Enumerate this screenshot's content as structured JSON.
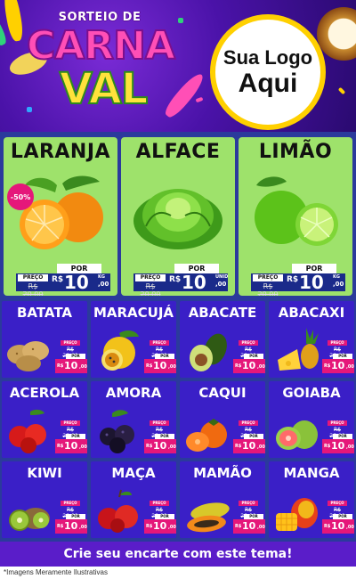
{
  "header": {
    "title_top": "SORTEIO DE",
    "title_line1": "CARNA",
    "title_line2": "VAL",
    "logo_line1": "Sua Logo",
    "logo_line2": "Aqui"
  },
  "featured": [
    {
      "name": "LARANJA",
      "badge": "-50%",
      "preco_label": "PREÇO",
      "old_price": "R$ 20,00",
      "por_label": "POR",
      "currency": "R$",
      "price": "10",
      "cents": ",00",
      "unit": "KG",
      "icon": "orange-icon"
    },
    {
      "name": "ALFACE",
      "badge": "",
      "preco_label": "PREÇO",
      "old_price": "R$ 20,00",
      "por_label": "POR",
      "currency": "R$",
      "price": "10",
      "cents": ",00",
      "unit": "UNID",
      "icon": "lettuce-icon"
    },
    {
      "name": "LIMÃO",
      "badge": "",
      "preco_label": "PREÇO",
      "old_price": "R$ 20,00",
      "por_label": "POR",
      "currency": "R$",
      "price": "10",
      "cents": ",00",
      "unit": "KG",
      "icon": "lime-icon"
    }
  ],
  "products": [
    {
      "name": "BATATA",
      "preco_label": "PREÇO",
      "old_price": "R$ 20,00",
      "por_label": "POR",
      "currency": "R$",
      "price": "10",
      "cents": ",00",
      "icon": "potato-icon"
    },
    {
      "name": "MARACUJÁ",
      "preco_label": "PREÇO",
      "old_price": "R$ 20,00",
      "por_label": "POR",
      "currency": "R$",
      "price": "10",
      "cents": ",00",
      "icon": "passion-fruit-icon"
    },
    {
      "name": "ABACATE",
      "preco_label": "PREÇO",
      "old_price": "R$ 20,00",
      "por_label": "POR",
      "currency": "R$",
      "price": "10",
      "cents": ",00",
      "icon": "avocado-icon"
    },
    {
      "name": "ABACAXI",
      "preco_label": "PREÇO",
      "old_price": "R$ 20,00",
      "por_label": "POR",
      "currency": "R$",
      "price": "10",
      "cents": ",00",
      "icon": "pineapple-icon"
    },
    {
      "name": "ACEROLA",
      "preco_label": "PREÇO",
      "old_price": "R$ 20,00",
      "por_label": "POR",
      "currency": "R$",
      "price": "10",
      "cents": ",00",
      "icon": "acerola-icon"
    },
    {
      "name": "AMORA",
      "preco_label": "PREÇO",
      "old_price": "R$ 20,00",
      "por_label": "POR",
      "currency": "R$",
      "price": "10",
      "cents": ",00",
      "icon": "blackberry-icon"
    },
    {
      "name": "CAQUI",
      "preco_label": "PREÇO",
      "old_price": "R$ 20,00",
      "por_label": "POR",
      "currency": "R$",
      "price": "10",
      "cents": ",00",
      "icon": "persimmon-icon"
    },
    {
      "name": "GOIABA",
      "preco_label": "PREÇO",
      "old_price": "R$ 20,00",
      "por_label": "POR",
      "currency": "R$",
      "price": "10",
      "cents": ",00",
      "icon": "guava-icon"
    },
    {
      "name": "KIWI",
      "preco_label": "PREÇO",
      "old_price": "R$ 20,00",
      "por_label": "POR",
      "currency": "R$",
      "price": "10",
      "cents": ",00",
      "icon": "kiwi-icon"
    },
    {
      "name": "MAÇA",
      "preco_label": "PREÇO",
      "old_price": "R$ 20,00",
      "por_label": "POR",
      "currency": "R$",
      "price": "10",
      "cents": ",00",
      "icon": "apple-icon"
    },
    {
      "name": "MAMÃO",
      "preco_label": "PREÇO",
      "old_price": "R$ 20,00",
      "por_label": "POR",
      "currency": "R$",
      "price": "10",
      "cents": ",00",
      "icon": "papaya-icon"
    },
    {
      "name": "MANGA",
      "preco_label": "PREÇO",
      "old_price": "R$ 20,00",
      "por_label": "POR",
      "currency": "R$",
      "price": "10",
      "cents": ",00",
      "icon": "mango-icon"
    }
  ],
  "footer": {
    "cta": "Crie seu encarte com este tema!",
    "disclaimer": "*Imagens Meramente Ilustrativas"
  },
  "colors": {
    "featured_bg": "#9ee26b",
    "card_bg": "#3a1fc7",
    "price_accent": "#e5177a",
    "header_purple": "#4a12a8"
  }
}
